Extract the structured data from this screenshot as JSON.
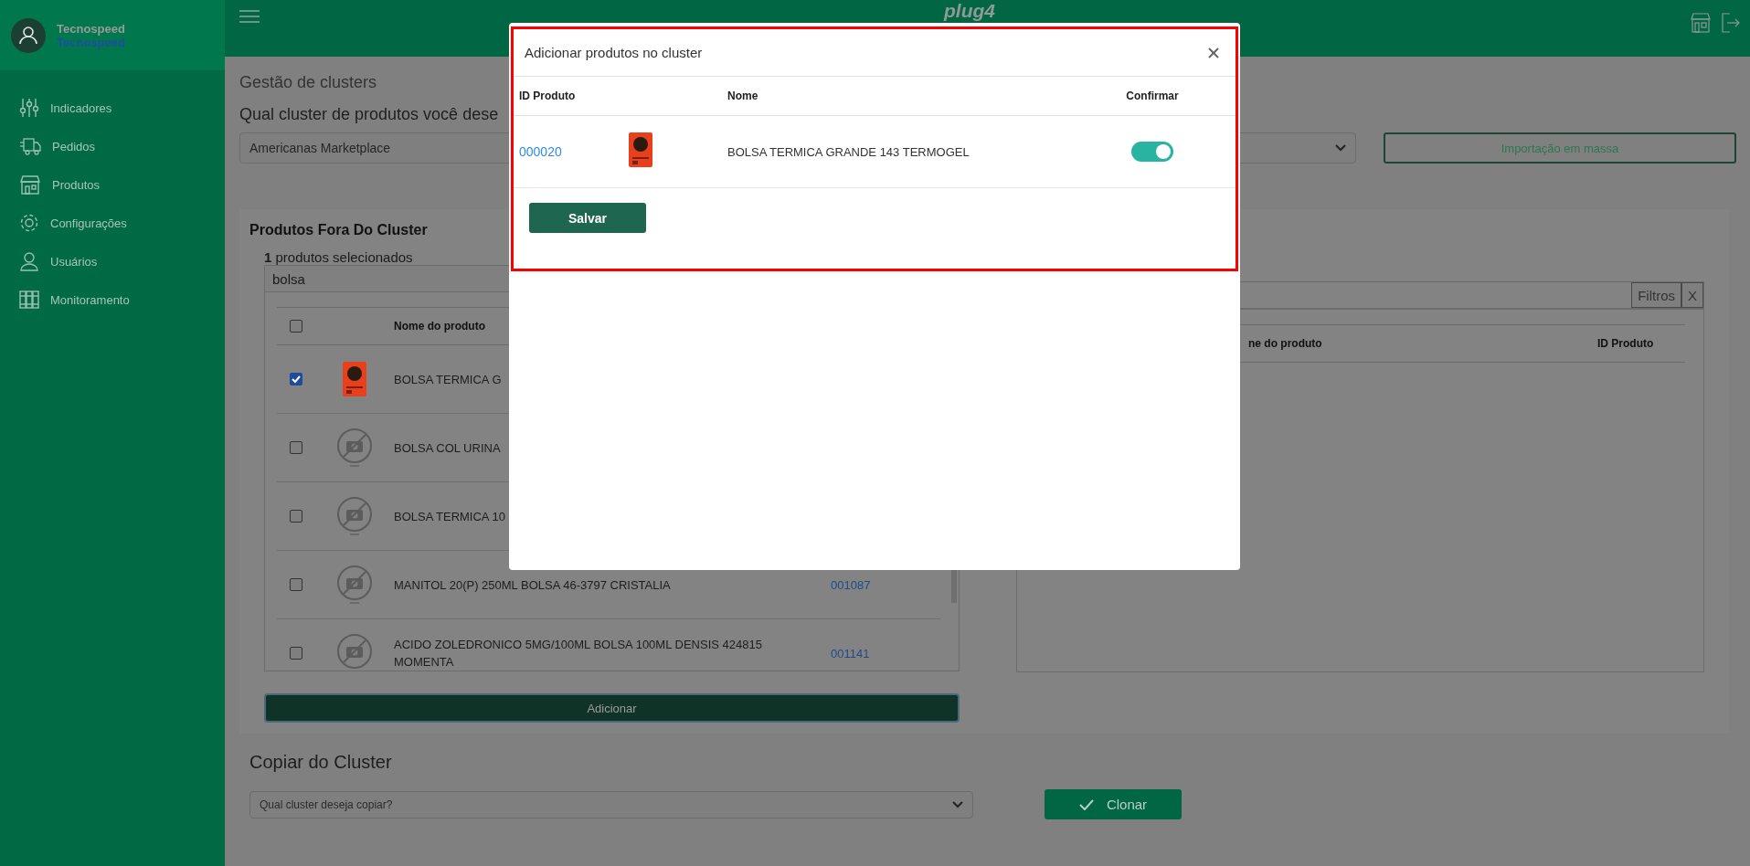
{
  "sidebar": {
    "user": {
      "name": "Tecnospeed",
      "company": "Tecnospeed"
    },
    "items": [
      {
        "label": "Indicadores"
      },
      {
        "label": "Pedidos"
      },
      {
        "label": "Produtos"
      },
      {
        "label": "Configurações"
      },
      {
        "label": "Usuários"
      },
      {
        "label": "Monitoramento"
      }
    ]
  },
  "header": {
    "logo": "plug4"
  },
  "page": {
    "title": "Gestão de clusters",
    "question": "Qual cluster de produtos você dese",
    "cluster_select": {
      "value": "Americanas Marketplace"
    },
    "import_button": "Importação em massa"
  },
  "left_panel": {
    "title": "Produtos Fora Do Cluster",
    "selection_count": "**1** produtos selecionados",
    "search": {
      "value": "bolsa"
    },
    "header_checked": false,
    "columns": [
      "Nome do produto"
    ],
    "rows": [
      {
        "checked": true,
        "kind": "photo",
        "name": "BOLSA TERMICA G"
      },
      {
        "checked": false,
        "kind": "nophoto",
        "name": "BOLSA COL URINA"
      },
      {
        "checked": false,
        "kind": "nophoto",
        "name": "BOLSA TERMICA 10"
      },
      {
        "checked": false,
        "kind": "nophoto",
        "name": "MANITOL 20(P) 250ML BOLSA 46-3797 CRISTALIA",
        "id": "001087"
      },
      {
        "checked": false,
        "kind": "nophoto",
        "name": "ACIDO ZOLEDRONICO 5MG/100ML BOLSA 100ML DENSIS 424815 MOMENTA",
        "id": "001141"
      }
    ],
    "add_button": "Adicionar"
  },
  "right_panel": {
    "filters_button": "Filtros",
    "clear_button": "X",
    "columns": [
      "ne do produto",
      "ID Produto"
    ]
  },
  "copy_section": {
    "title": "Copiar do Cluster",
    "select": {
      "placeholder": "Qual cluster deseja copiar?"
    },
    "clone_button": "Clonar"
  },
  "modal": {
    "title": "Adicionar produtos no cluster",
    "columns": [
      "ID Produto",
      "Nome",
      "Confirmar"
    ],
    "rows": [
      {
        "id": "000020",
        "kind": "photo",
        "name": "BOLSA TERMICA GRANDE 143 TERMOGEL",
        "confirmed": true
      }
    ],
    "save_button": "Salvar"
  }
}
